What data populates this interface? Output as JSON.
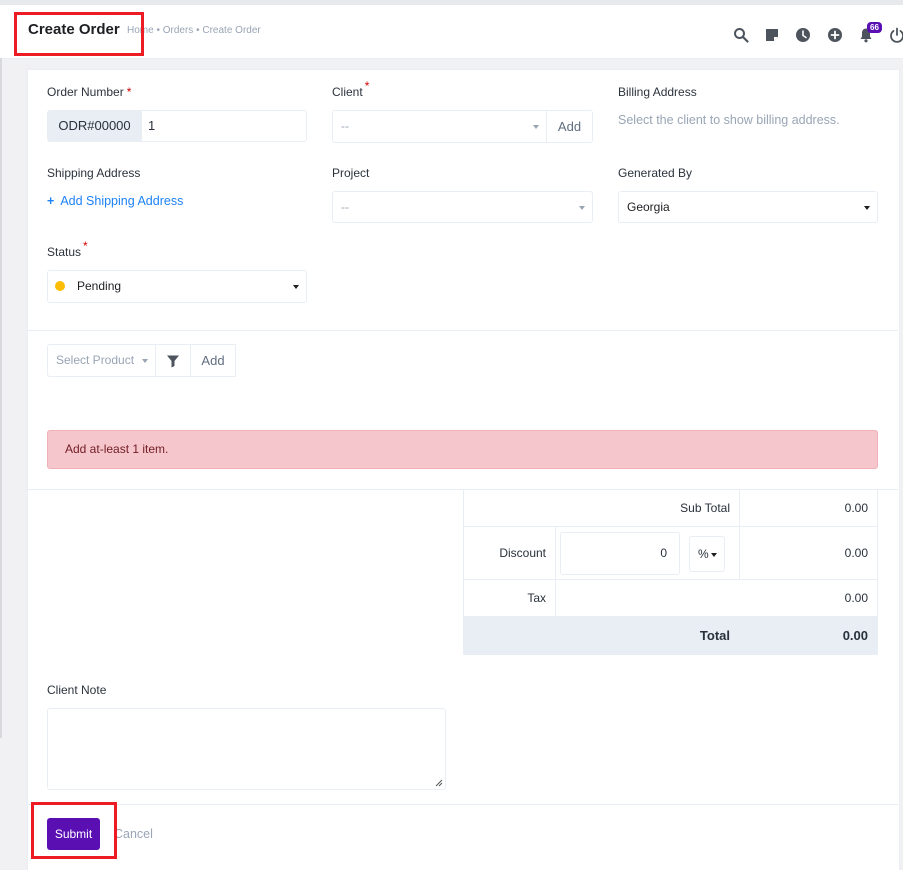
{
  "header": {
    "title": "Create Order",
    "breadcrumb": [
      "Home",
      "Orders",
      "Create Order"
    ],
    "notification_count": "66",
    "icons": [
      "search-icon",
      "sticky-note-icon",
      "clock-icon",
      "plus-circle-icon",
      "bell-icon",
      "power-icon"
    ]
  },
  "form": {
    "order_number": {
      "label": "Order Number",
      "required": "*",
      "prefix": "ODR#00000",
      "value": "1"
    },
    "client": {
      "label": "Client",
      "required": "*",
      "value": "--",
      "add_label": "Add"
    },
    "billing_address": {
      "label": "Billing Address",
      "hint": "Select the client to show billing address."
    },
    "shipping_address": {
      "label": "Shipping Address",
      "link": "Add Shipping Address"
    },
    "project": {
      "label": "Project",
      "value": "--"
    },
    "generated_by": {
      "label": "Generated By",
      "value": "Georgia"
    },
    "status": {
      "label": "Status",
      "required": "*",
      "value": "Pending",
      "dot_color": "#fcbd01"
    }
  },
  "product": {
    "placeholder": "Select Product",
    "add_label": "Add"
  },
  "alert": {
    "message": "Add at-least 1 item."
  },
  "summary": {
    "subtotal_label": "Sub Total",
    "subtotal_value": "0.00",
    "discount_label": "Discount",
    "discount_input": "0",
    "discount_type": "%",
    "discount_value": "0.00",
    "tax_label": "Tax",
    "tax_value": "0.00",
    "total_label": "Total",
    "total_value": "0.00"
  },
  "client_note": {
    "label": "Client Note",
    "value": ""
  },
  "actions": {
    "submit_label": "Submit",
    "cancel_label": "Cancel"
  },
  "colors": {
    "accent": "#5a0fb3",
    "link": "#1d82f5",
    "highlight": "#ed1b24",
    "alert_bg": "#f5c6cb"
  }
}
